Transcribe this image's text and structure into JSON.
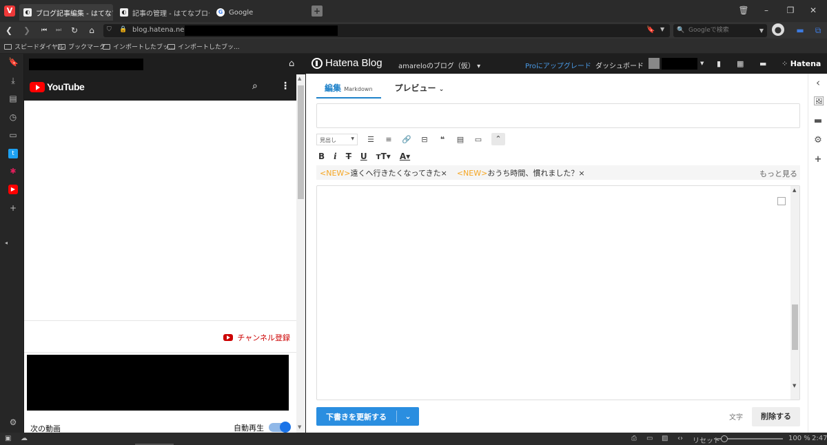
{
  "browser": {
    "tabs": [
      {
        "label": "ブログ記事編集 - はてなブログ",
        "active": true
      },
      {
        "label": "記事の管理 - はてなブログ",
        "active": false
      },
      {
        "label": "Google",
        "active": false
      }
    ],
    "url": "blog.hatena.ne.jp/",
    "search_placeholder": "Googleで検索",
    "bookmarks": [
      "スピードダイヤル",
      "ブックマーク",
      "インポートしたブッ...",
      "インポートしたブッ..."
    ]
  },
  "web_panel": {
    "youtube_logo": "YouTube",
    "subscribe": "チャンネル登録",
    "next_video": "次の動画",
    "autoplay": "自動再生"
  },
  "hatena": {
    "logo": "Hatena Blog",
    "blog_name": "amareloのブログ（仮） ▾",
    "pro_upgrade": "Proにアップグレード",
    "dashboard": "ダッシュボード",
    "hatena_brand": "Hatena",
    "tab_edit": "編集",
    "tab_edit_mode": "Markdown",
    "tab_preview": "プレビュー",
    "heading_select": "見出し",
    "tags": [
      {
        "new": "<NEW>",
        "label": "遠くへ行きたくなってきた×"
      },
      {
        "new": "<NEW>",
        "label": "おうち時間、慣れました？×"
      }
    ],
    "more": "もっと見る",
    "update_button": "下書きを更新する",
    "char_count_label": "文字",
    "delete_button": "削除する"
  },
  "status": {
    "reset": "リセット",
    "zoom": "100 %",
    "time": "2:47"
  },
  "colors": {
    "accent_blue": "#2a8ee0",
    "new_tag": "#f5a623",
    "youtube_red": "#ff0000"
  }
}
